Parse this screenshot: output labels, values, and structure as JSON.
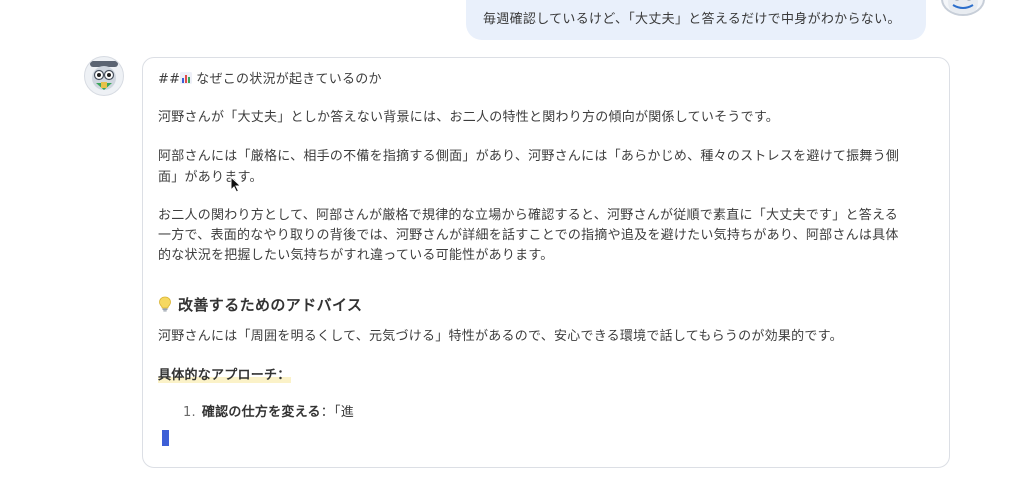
{
  "user_message": {
    "text": "毎週確認しているけど、「大丈夫」と答えるだけで中身がわからない。"
  },
  "assistant_message": {
    "heading_prefix": "##",
    "heading_text": "なぜこの状況が起きているのか",
    "para1": "河野さんが「大丈夫」としか答えない背景には、お二人の特性と関わり方の傾向が関係していそうです。",
    "para2_line1": "阿部さんには「厳格に、相手の不備を指摘する側面」があり、河野さんには「あらかじめ、種々のストレスを避けて振舞う側",
    "para2_line2": "面」があります。",
    "para3_line1": "お二人の関わり方として、阿部さんが厳格で規律的な立場から確認すると、河野さんが従順で素直に「大丈夫です」と答える",
    "para3_line2": "一方で、表面的なやり取りの背後では、河野さんが詳細を話すことでの指摘や追及を避けたい気持ちがあり、阿部さんは具体",
    "para3_line3": "的な状況を把握したい気持ちがすれ違っている可能性があります。",
    "section_title": "改善するためのアドバイス",
    "para4": "河野さんには「周囲を明るくして、元気づける」特性があるので、安心できる環境で話してもらうのが効果的です。",
    "approach_label": "具体的なアプローチ：",
    "list_item_number": "1.",
    "list_item_bold": "確認の仕方を変える",
    "list_item_rest": "：「進"
  },
  "icons": {
    "heading_icon": "bar-chart-icon",
    "section_icon": "lightbulb-icon",
    "user_avatar": "robot-avatar",
    "assistant_avatar": "robot-avatar",
    "cursor": "mouse-pointer-icon"
  },
  "colors": {
    "user_bubble_bg": "#e9f0fb",
    "streaming_cursor": "#3d5fd6",
    "highlight": "#fbf2c8"
  }
}
